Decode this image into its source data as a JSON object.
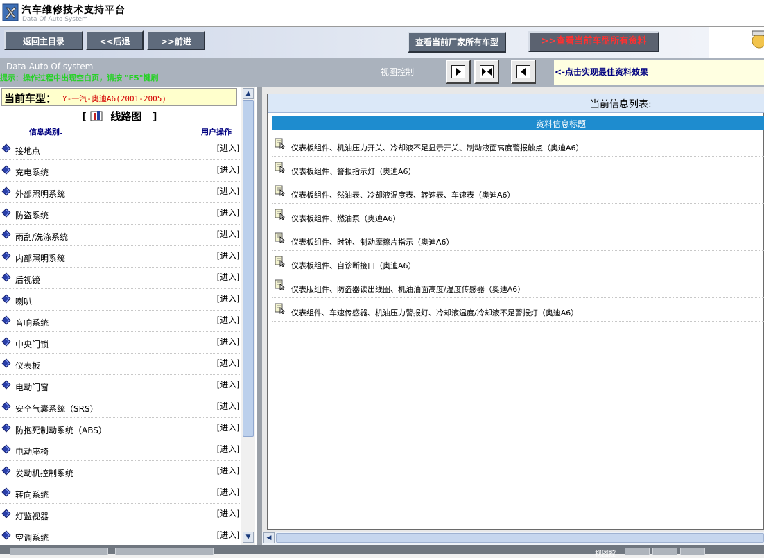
{
  "app": {
    "title": "汽车维修技术支持平台",
    "subtitle": "Data Of Auto System"
  },
  "toolbar": {
    "home_label": "返回主目录",
    "back_label": "<<后退",
    "forward_label": ">>前进",
    "maker_models_label": "查看当前厂家所有车型",
    "all_data_arrow": ">>",
    "all_data_label": "查看当前车型所有资料"
  },
  "statusbar": {
    "brand": "Data-Auto Of system",
    "hint": "提示：操作过程中出现空白页，请按 \"F5\"键刷",
    "view_control_label": "视图控制",
    "view_hint": "<-点击实现最佳资料效果"
  },
  "left_panel": {
    "car_label": "当前车型：",
    "car_value": "Y-一汽-奥迪A6(2001-2005)",
    "section_open": "[",
    "section_title": "线路图",
    "section_close": "]",
    "col_category": "信息类别.",
    "col_action": "用户操作",
    "enter_label": "[进入]",
    "items": [
      "接地点",
      "充电系统",
      "外部照明系统",
      "防盗系统",
      "雨刮/洗涤系统",
      "内部照明系统",
      "后视镜",
      "喇叭",
      "音响系统",
      "中央门锁",
      "仪表板",
      "电动门窗",
      "安全气囊系统（SRS）",
      "防抱死制动系统（ABS）",
      "电动座椅",
      "发动机控制系统",
      "转向系统",
      "灯监视器",
      "空调系统"
    ]
  },
  "right_panel": {
    "list_title": "当前信息列表:",
    "column_header": "资料信息标题",
    "items": [
      "仪表板组件、机油压力开关、冷却液不足显示开关、制动液面高度警报触点（奥迪A6）",
      "仪表板组件、警报指示灯（奥迪A6）",
      "仪表板组件、然油表、冷却液温度表、转速表、车速表（奥迪A6）",
      "仪表板组件、燃油泵（奥迪A6）",
      "仪表板组件、时钟、制动摩擦片指示（奥迪A6）",
      "仪表板组件、自诊断接口（奥迪A6）",
      "仪表版组件、防盗器读出线圈、机油油面高度/温度传感器（奥迪A6）",
      "仪表组件、车速传感器、机油压力警报灯、冷却液温度/冷却液不足警报灯（奥迪A6）"
    ]
  },
  "footer": {
    "view_label": "视图控"
  },
  "colors": {
    "toolbar_button": "#5f6b7c",
    "accent_red": "#ff3030",
    "hint_green": "#27d127",
    "list_header_blue": "#1e8ccf",
    "car_value_red": "#d40000"
  }
}
